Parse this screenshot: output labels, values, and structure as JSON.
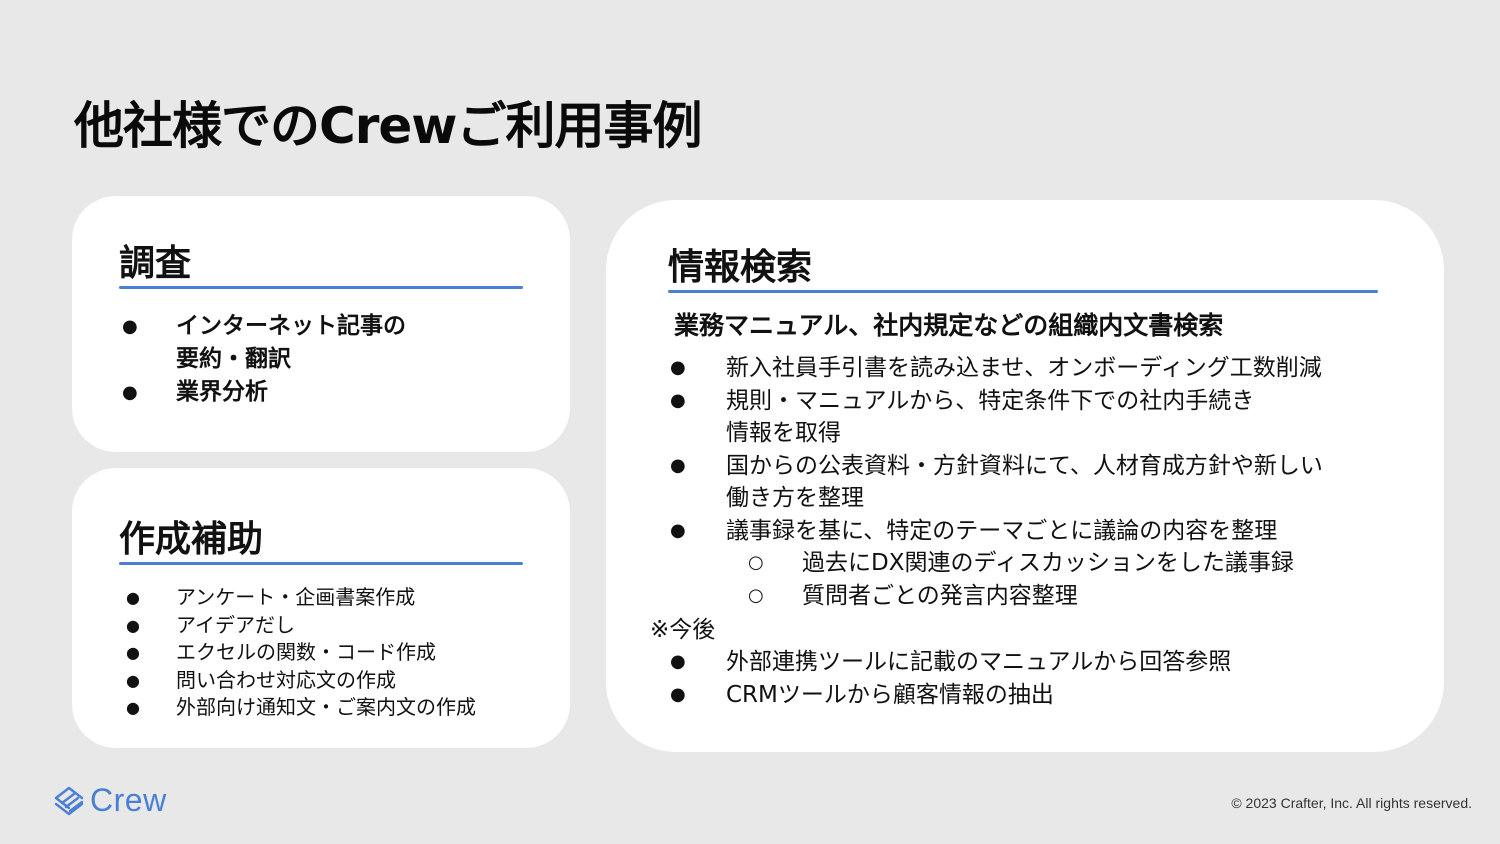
{
  "slide": {
    "title": "他社様でのCrewご利用事例"
  },
  "research": {
    "heading": "調査",
    "items": [
      "インターネット記事の",
      "要約・翻訳",
      "業界分析"
    ]
  },
  "writing": {
    "heading": "作成補助",
    "items": [
      "アンケート・企画書案作成",
      "アイデアだし",
      "エクセルの関数・コード作成",
      "問い合わせ対応文の作成",
      "外部向け通知文・ご案内文の作成"
    ]
  },
  "search": {
    "heading": "情報検索",
    "subheading": "業務マニュアル、社内規定などの組織内文書検索",
    "items": [
      "新入社員手引書を読み込ませ、オンボーディング工数削減",
      "規則・マニュアルから、特定条件下での社内手続き",
      "情報を取得",
      "国からの公表資料・方針資料にて、人材育成方針や新しい",
      "働き方を整理",
      "議事録を基に、特定のテーマごとに議論の内容を整理"
    ],
    "sub_items": [
      "過去にDX関連のディスカッションをした議事録",
      "質問者ごとの発言内容整理"
    ],
    "note": "※今後",
    "future_items": [
      "外部連携ツールに記載のマニュアルから回答参照",
      "CRMツールから顧客情報の抽出"
    ]
  },
  "bullets": {
    "filled": "●",
    "hollow": "○"
  },
  "footer": {
    "logo_text": "Crew",
    "copyright": "© 2023 Crafter, Inc. All rights reserved."
  },
  "colors": {
    "background": "#e8e8e8",
    "card": "#ffffff",
    "accent": "#4a7fd6",
    "text": "#111111"
  }
}
